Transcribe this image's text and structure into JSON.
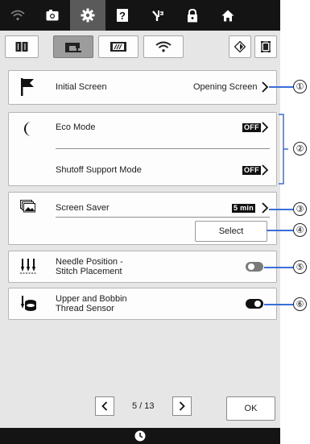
{
  "colors": {
    "accent": "#3a6fd8",
    "topbar": "#141414",
    "panel": "#fdfdfd",
    "background": "#e6e6e6"
  },
  "topbar": {
    "icons": [
      "wifi-icon",
      "camera-icon",
      "gear-icon",
      "help-icon",
      "needle-threader-icon",
      "lock-icon",
      "home-icon"
    ],
    "active": "gear-icon"
  },
  "tabs": [
    "book-icon",
    "sewing-machine-icon",
    "embroidery-icon",
    "wifi-icon"
  ],
  "settings": {
    "initial_screen": {
      "label": "Initial Screen",
      "value": "Opening Screen",
      "callout": "①"
    },
    "eco_mode": {
      "label": "Eco Mode",
      "value": "OFF",
      "callout": "②"
    },
    "shutoff_support": {
      "label": "Shutoff Support Mode",
      "value": "OFF"
    },
    "screen_saver": {
      "label": "Screen Saver",
      "value": "5 min",
      "callout": "③"
    },
    "select": {
      "label": "Select",
      "callout": "④"
    },
    "needle_position": {
      "label_line1": "Needle Position -",
      "label_line2": "Stitch Placement",
      "state": "off",
      "callout": "⑤"
    },
    "thread_sensor": {
      "label_line1": "Upper and Bobbin",
      "label_line2": "Thread Sensor",
      "state": "on",
      "callout": "⑥"
    }
  },
  "pagination": {
    "text": "5 / 13"
  },
  "ok_label": "OK"
}
